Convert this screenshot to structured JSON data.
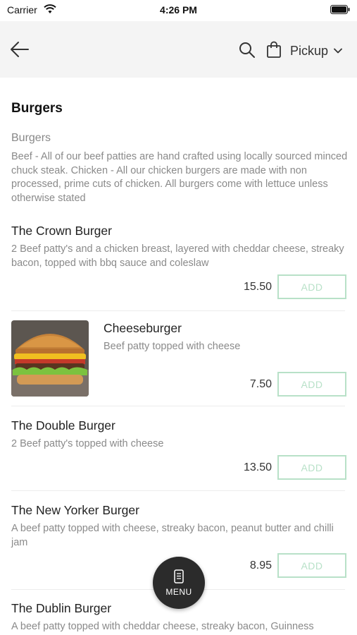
{
  "status_bar": {
    "carrier": "Carrier",
    "time": "4:26 PM"
  },
  "nav": {
    "pickup_label": "Pickup"
  },
  "section": {
    "title": "Burgers",
    "category_name": "Burgers",
    "category_description": "Beef - All of our beef patties are hand crafted using locally sourced minced chuck steak. Chicken - All our chicken burgers are made with non processed, prime cuts of chicken. All burgers come with lettuce unless otherwise stated"
  },
  "items": [
    {
      "title": "The Crown Burger",
      "description": "2 Beef patty's and a chicken breast, layered with cheddar cheese, streaky bacon, topped with bbq sauce and coleslaw",
      "price": "15.50",
      "add_label": "ADD"
    },
    {
      "title": "Cheeseburger",
      "description": "Beef patty topped with cheese",
      "price": "7.50",
      "add_label": "ADD"
    },
    {
      "title": "The Double Burger",
      "description": "2 Beef patty's topped with cheese",
      "price": "13.50",
      "add_label": "ADD"
    },
    {
      "title": "The New Yorker Burger",
      "description": "A beef patty topped with cheese, streaky bacon, peanut butter and chilli jam",
      "price": "8.95",
      "add_label": "ADD"
    },
    {
      "title": "The Dublin Burger",
      "description": "A beef patty topped with cheddar cheese, streaky bacon, Guinness"
    }
  ],
  "menu_button": {
    "label": "MENU"
  },
  "colors": {
    "accent_outline": "#b8e1c8",
    "nav_background": "#f4f4f4",
    "fab_background": "#2b2b2b"
  }
}
